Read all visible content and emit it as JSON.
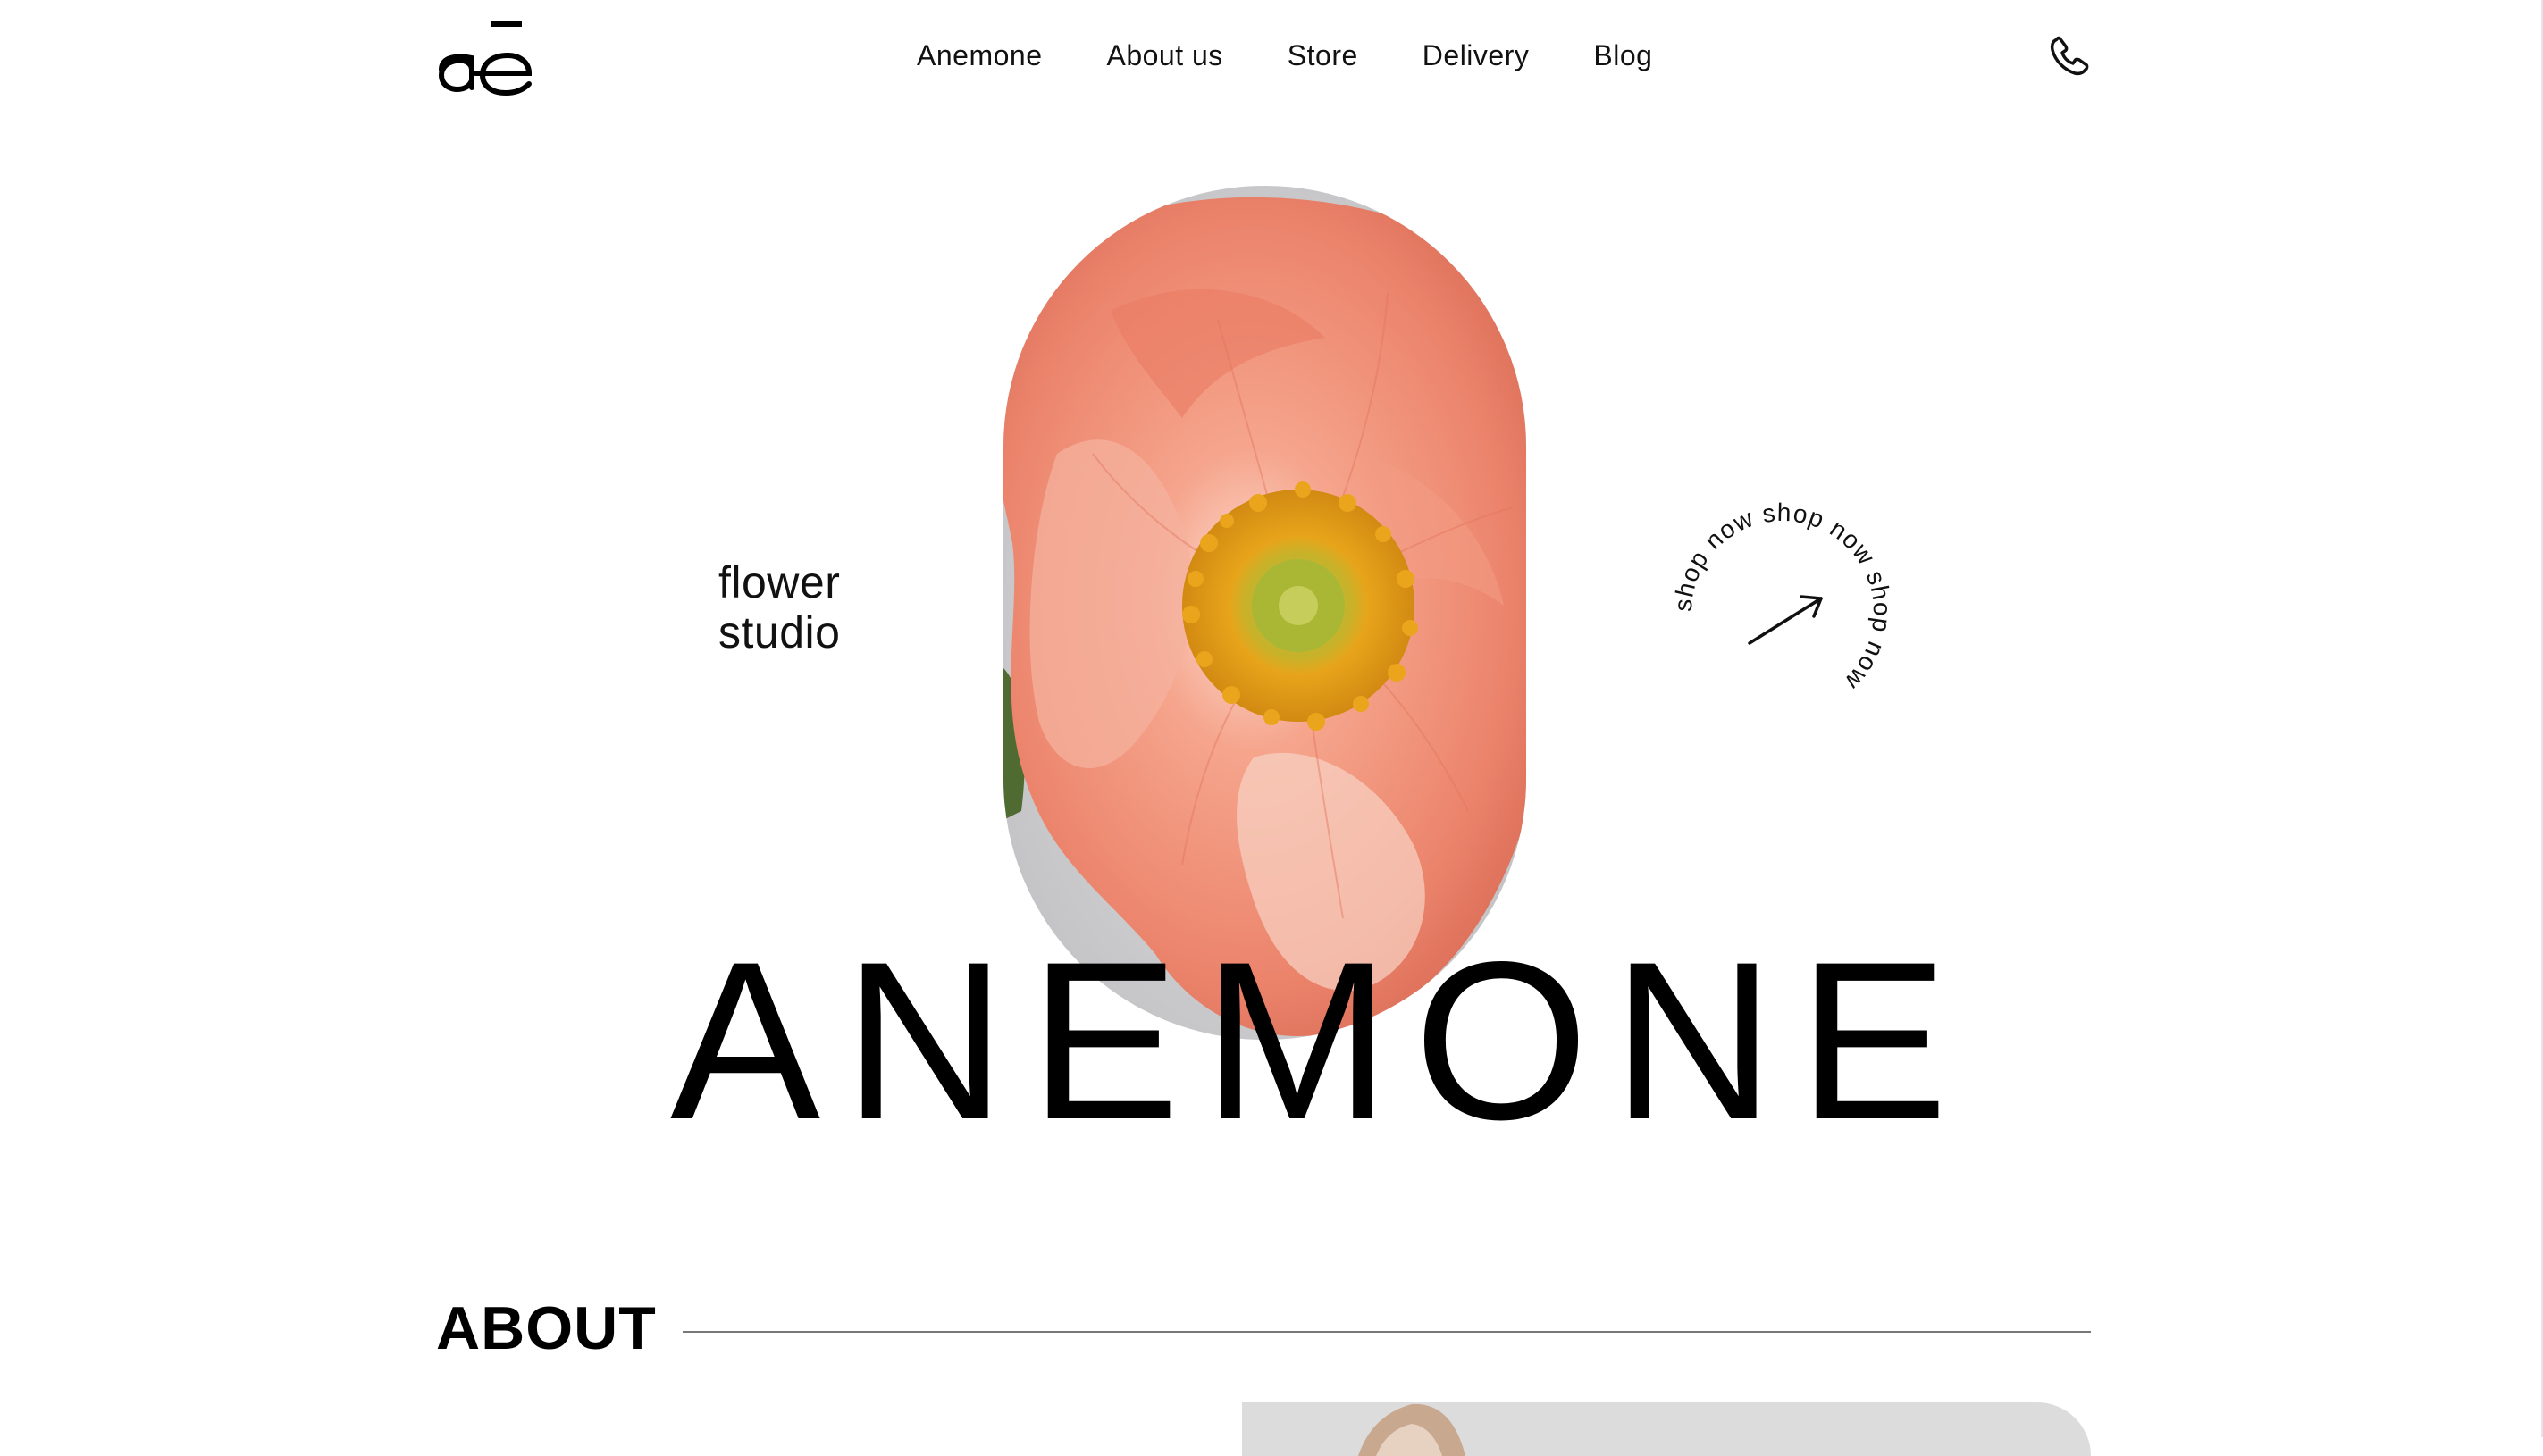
{
  "header": {
    "logo_text": "ǣ",
    "nav": [
      {
        "label": "Anemone"
      },
      {
        "label": "About us"
      },
      {
        "label": "Store"
      },
      {
        "label": "Delivery"
      },
      {
        "label": "Blog"
      }
    ],
    "phone_icon": "phone-icon"
  },
  "hero": {
    "side_text_line1": "flower",
    "side_text_line2": "studio",
    "badge_text": "shop now shop now shop now ",
    "badge_icon": "arrow-up-right-icon",
    "title": "ANEMONE",
    "image_icon": "poppy-flower-image"
  },
  "about": {
    "heading": "ABOUT"
  },
  "colors": {
    "petal": "#ec8a74",
    "petal_light": "#f7c0ad",
    "stamen": "#e3a21b",
    "center": "#a8b533",
    "background_photo": "#cfcfd1"
  }
}
